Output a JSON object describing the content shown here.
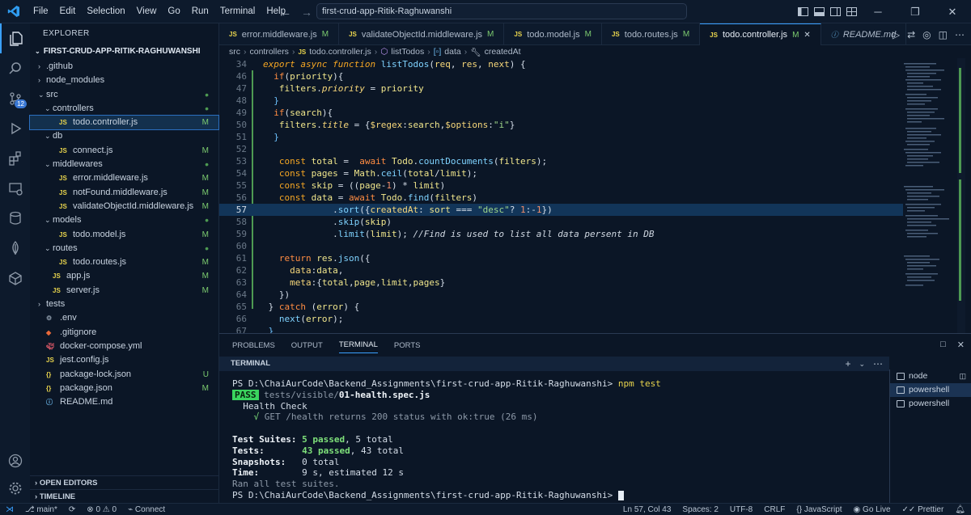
{
  "window": {
    "menu": [
      "File",
      "Edit",
      "Selection",
      "View",
      "Go",
      "Run",
      "Terminal",
      "Help"
    ],
    "command_center": "first-crud-app-Ritik-Raghuwanshi"
  },
  "activity": {
    "scm_badge": "12"
  },
  "sidebar": {
    "header": "EXPLORER",
    "project": "FIRST-CRUD-APP-RITIK-RAGHUWANSHI",
    "items": [
      {
        "label": ".github",
        "type": "folder",
        "status": ""
      },
      {
        "label": "node_modules",
        "type": "folder",
        "status": ""
      },
      {
        "label": "src",
        "type": "folder-open",
        "status": "dot"
      },
      {
        "label": "controllers",
        "type": "folder-open",
        "status": "dot"
      },
      {
        "label": "todo.controller.js",
        "type": "js",
        "status": "M"
      },
      {
        "label": "db",
        "type": "folder-open",
        "status": ""
      },
      {
        "label": "connect.js",
        "type": "js",
        "status": "M"
      },
      {
        "label": "middlewares",
        "type": "folder-open",
        "status": "dot"
      },
      {
        "label": "error.middleware.js",
        "type": "js",
        "status": "M"
      },
      {
        "label": "notFound.middleware.js",
        "type": "js",
        "status": "M"
      },
      {
        "label": "validateObjectId.middleware.js",
        "type": "js",
        "status": "M"
      },
      {
        "label": "models",
        "type": "folder-open",
        "status": "dot"
      },
      {
        "label": "todo.model.js",
        "type": "js",
        "status": "M"
      },
      {
        "label": "routes",
        "type": "folder-open",
        "status": "dot"
      },
      {
        "label": "todo.routes.js",
        "type": "js",
        "status": "M"
      },
      {
        "label": "app.js",
        "type": "js",
        "status": "M"
      },
      {
        "label": "server.js",
        "type": "js",
        "status": "M"
      },
      {
        "label": "tests",
        "type": "folder",
        "status": ""
      },
      {
        "label": ".env",
        "type": "env",
        "status": ""
      },
      {
        "label": ".gitignore",
        "type": "git",
        "status": ""
      },
      {
        "label": "docker-compose.yml",
        "type": "docker",
        "status": ""
      },
      {
        "label": "jest.config.js",
        "type": "js",
        "status": ""
      },
      {
        "label": "package-lock.json",
        "type": "json",
        "status": "U"
      },
      {
        "label": "package.json",
        "type": "json",
        "status": "M"
      },
      {
        "label": "README.md",
        "type": "md",
        "status": ""
      }
    ],
    "open_editors": "OPEN EDITORS",
    "timeline": "TIMELINE"
  },
  "tabs": [
    {
      "label": "error.middleware.js",
      "mod": "M"
    },
    {
      "label": "validateObjectId.middleware.js",
      "mod": "M"
    },
    {
      "label": "todo.model.js",
      "mod": "M"
    },
    {
      "label": "todo.routes.js",
      "mod": "M"
    },
    {
      "label": "todo.controller.js",
      "mod": "M"
    },
    {
      "label": "README.md",
      "mod": ""
    }
  ],
  "breadcrumb": [
    "src",
    "controllers",
    "todo.controller.js",
    "listTodos",
    "data",
    "createdAt"
  ],
  "editor": {
    "line_numbers": [
      "34",
      "46",
      "47",
      "48",
      "49",
      "50",
      "51",
      "52",
      "53",
      "54",
      "55",
      "56",
      "57",
      "58",
      "59",
      "60",
      "61",
      "62",
      "63",
      "64",
      "65",
      "66",
      "67"
    ],
    "current_line": "57"
  },
  "panel": {
    "tabs": [
      "PROBLEMS",
      "OUTPUT",
      "TERMINAL",
      "PORTS"
    ],
    "terminal_header": "TERMINAL",
    "prompt": "PS D:\\ChaiAurCode\\Backend_Assignments\\first-crud-app-Ritik-Raghuwanshi>",
    "command": "npm test",
    "pass_badge": "PASS",
    "test_path_dim": "tests/visible/",
    "test_file": "01-health.spec.js",
    "suite_name": "Health Check",
    "check_mark": "√",
    "test_case": "GET /health returns 200 status with ok:true (26 ms)",
    "summary": {
      "suites_label": "Test Suites:",
      "suites_pass": "5 passed",
      "suites_total": ", 5 total",
      "tests_label": "Tests:",
      "tests_pass": "43 passed",
      "tests_total": ", 43 total",
      "snap_label": "Snapshots:",
      "snap_value": "0 total",
      "time_label": "Time:",
      "time_value": "9 s, estimated 12 s",
      "ran": "Ran all test suites."
    },
    "terminals": [
      "node",
      "powershell",
      "powershell"
    ]
  },
  "status": {
    "branch": "main*",
    "errors": "0",
    "warnings": "0",
    "connect": "Connect",
    "position": "Ln 57, Col 43",
    "spaces": "Spaces: 2",
    "encoding": "UTF-8",
    "eol": "CRLF",
    "language": "JavaScript",
    "golive": "Go Live",
    "prettier": "Prettier"
  },
  "colors": {
    "accent": "#3aa0ff",
    "background": "#0b1626",
    "pass": "#3ad45e",
    "modified": "#7ccb6f"
  }
}
